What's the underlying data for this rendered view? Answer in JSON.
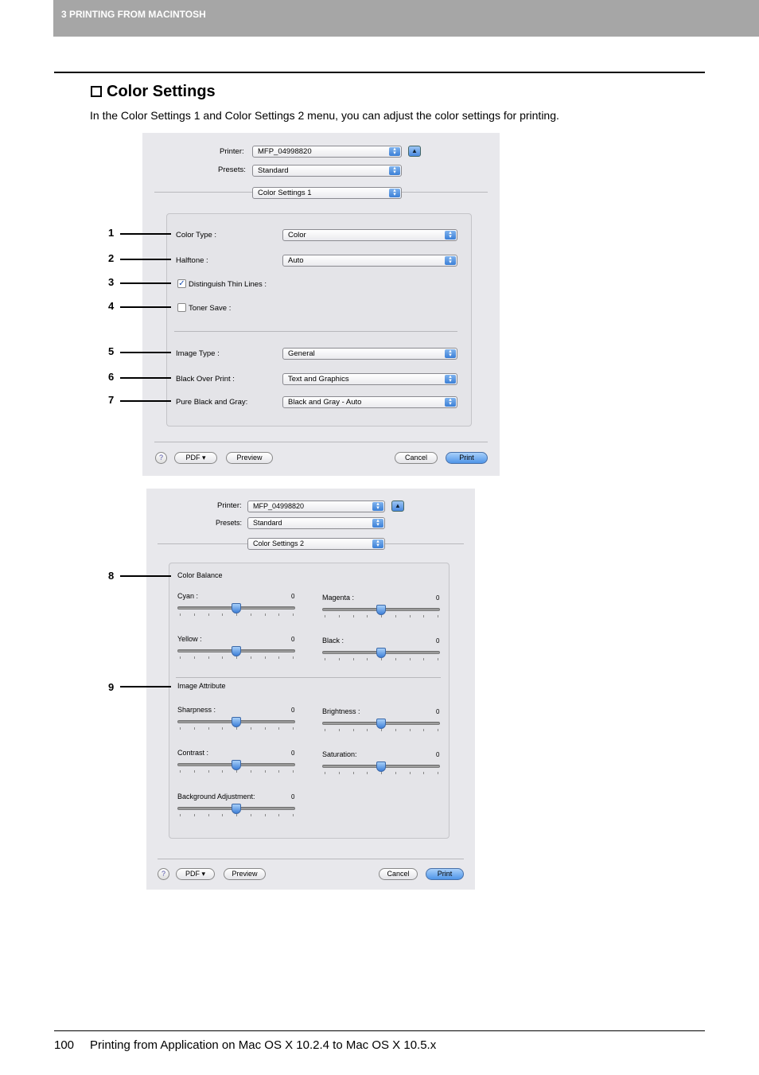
{
  "header": {
    "section": "3 PRINTING FROM MACINTOSH"
  },
  "title": "Color Settings",
  "intro": "In the Color Settings 1 and Color Settings 2 menu, you can adjust the color settings for printing.",
  "dialog1": {
    "printer_label": "Printer:",
    "printer": "MFP_04998820",
    "presets_label": "Presets:",
    "presets": "Standard",
    "panel": "Color Settings 1",
    "rows": [
      {
        "num": "1",
        "label": "Color Type :",
        "value": "Color"
      },
      {
        "num": "2",
        "label": "Halftone :",
        "value": "Auto"
      },
      {
        "num": "3",
        "label": "Distinguish Thin Lines :",
        "checked": true
      },
      {
        "num": "4",
        "label": "Toner Save :",
        "checked": false
      },
      {
        "num": "5",
        "label": "Image Type :",
        "value": "General"
      },
      {
        "num": "6",
        "label": "Black Over Print :",
        "value": "Text and Graphics"
      },
      {
        "num": "7",
        "label": "Pure Black and Gray:",
        "value": "Black and Gray - Auto"
      }
    ],
    "help": "?",
    "pdf": "PDF ▾",
    "preview": "Preview",
    "cancel": "Cancel",
    "print": "Print"
  },
  "dialog2": {
    "printer_label": "Printer:",
    "printer": "MFP_04998820",
    "presets_label": "Presets:",
    "presets": "Standard",
    "panel": "Color Settings 2",
    "color_balance": {
      "num": "8",
      "label": "Color Balance"
    },
    "image_attribute": {
      "num": "9",
      "label": "Image Attribute"
    },
    "sliders": [
      {
        "label": "Cyan :",
        "value": "0",
        "level": 0.5
      },
      {
        "label": "Magenta :",
        "value": "0",
        "level": 0.5
      },
      {
        "label": "Yellow :",
        "value": "0",
        "level": 0.5
      },
      {
        "label": "Black :",
        "value": "0",
        "level": 0.5
      },
      {
        "label": "Sharpness :",
        "value": "0",
        "level": 0.5
      },
      {
        "label": "Brightness :",
        "value": "0",
        "level": 0.5
      },
      {
        "label": "Contrast :",
        "value": "0",
        "level": 0.5
      },
      {
        "label": "Saturation:",
        "value": "0",
        "level": 0.5
      },
      {
        "label": "Background Adjustment:",
        "value": "0",
        "level": 0.5
      }
    ],
    "help": "?",
    "pdf": "PDF ▾",
    "preview": "Preview",
    "cancel": "Cancel",
    "print": "Print"
  },
  "footer": {
    "page": "100",
    "text": "Printing from Application on Mac OS X 10.2.4 to Mac OS X 10.5.x"
  }
}
